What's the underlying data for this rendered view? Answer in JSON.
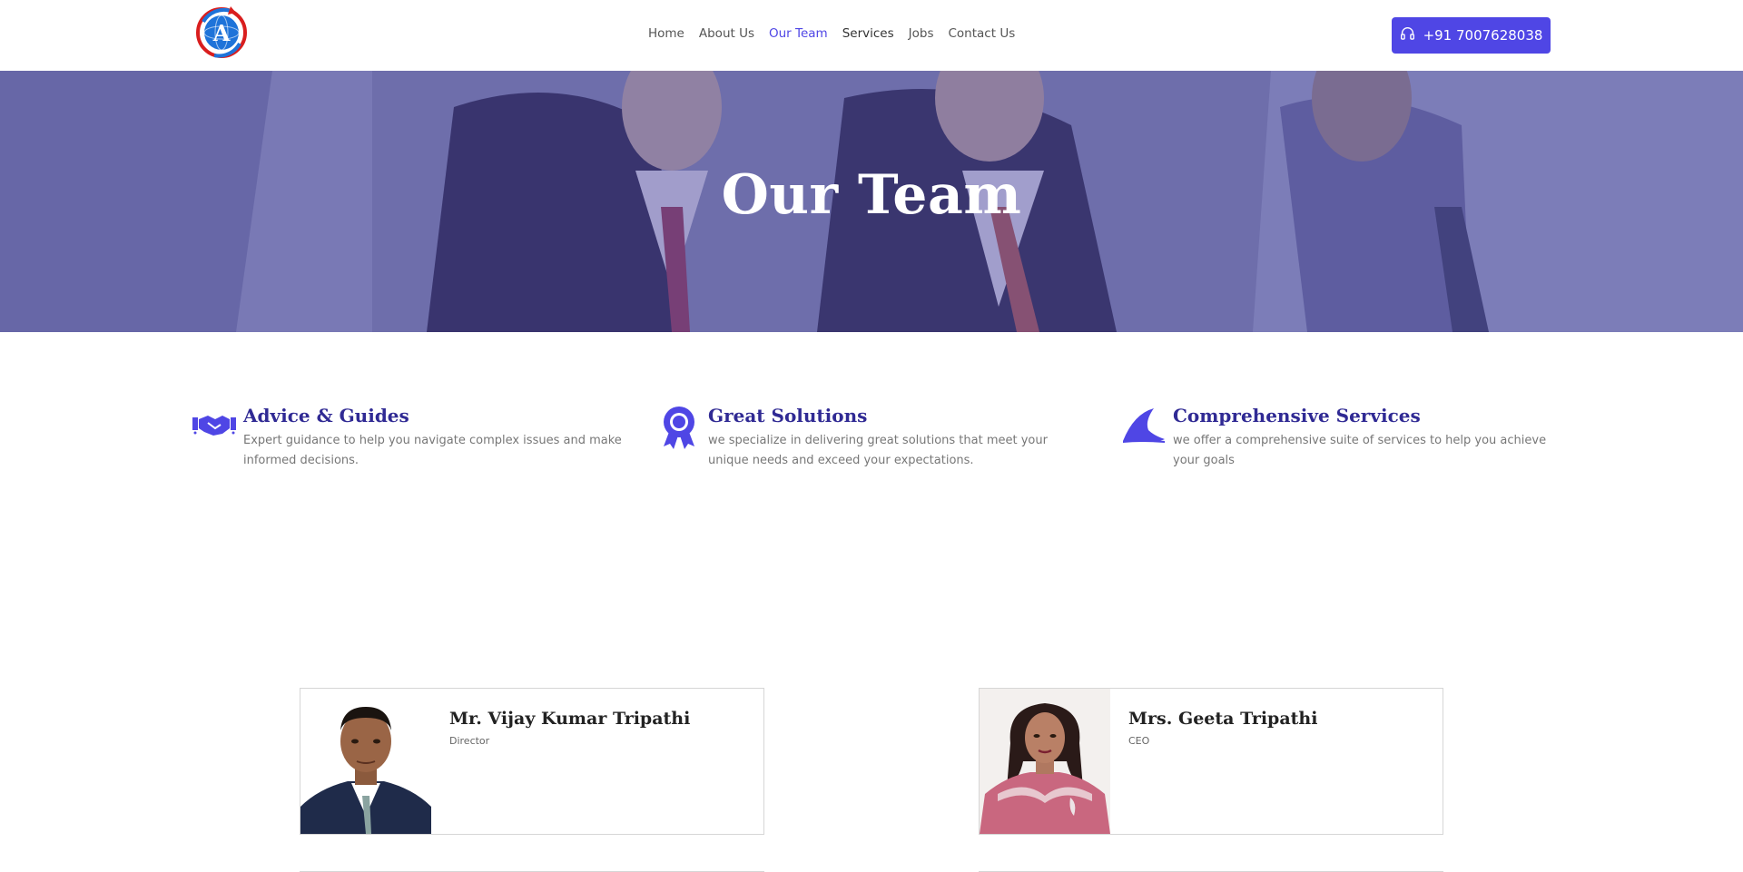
{
  "nav": {
    "items": [
      {
        "label": "Home"
      },
      {
        "label": "About Us"
      },
      {
        "label": "Our Team"
      },
      {
        "label": "Services"
      },
      {
        "label": "Jobs"
      },
      {
        "label": "Contact Us"
      }
    ],
    "active": "Our Team"
  },
  "header": {
    "phone_label": "+91 7007628038"
  },
  "logo": {
    "letter": "A"
  },
  "hero": {
    "title": "Our Team"
  },
  "features": [
    {
      "icon": "handshake-icon",
      "title": "Advice & Guides",
      "description": "Expert guidance to help you navigate complex issues and make informed decisions."
    },
    {
      "icon": "award-ribbon-icon",
      "title": "Great Solutions",
      "description": "we specialize in delivering great solutions that meet your unique needs and exceed your expectations."
    },
    {
      "icon": "shark-fin-icon",
      "title": "Comprehensive Services",
      "description": "we offer a comprehensive suite of services to help you achieve your goals"
    }
  ],
  "team": [
    {
      "name": "Mr. Vijay Kumar Tripathi",
      "role": "Director"
    },
    {
      "name": "Mrs. Geeta Tripathi",
      "role": "CEO"
    }
  ],
  "colors": {
    "accent": "#4f46e5",
    "heading": "#302a94",
    "hero_overlay": "#4b46a0"
  }
}
